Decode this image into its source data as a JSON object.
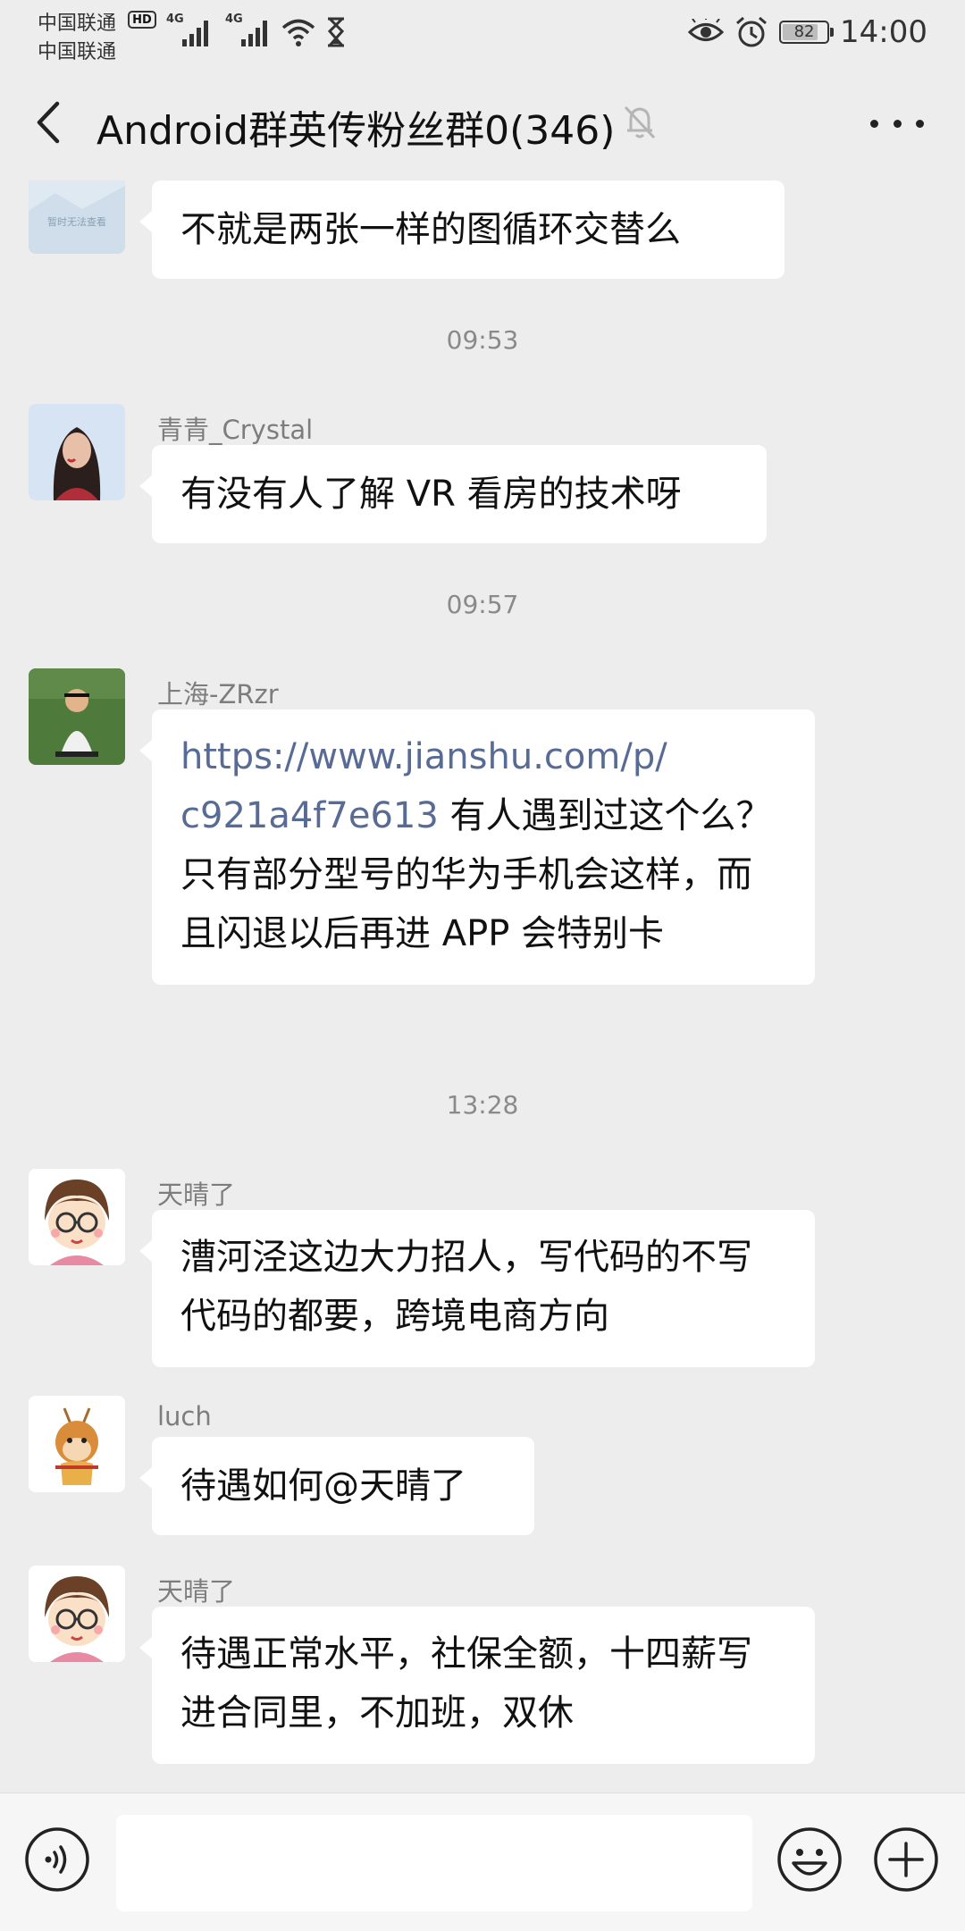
{
  "status_bar": {
    "carrier_1": "中国联通",
    "carrier_2": "中国联通",
    "hd_badge": "HD",
    "network_1": "4G",
    "network_2": "4G",
    "battery_level": "82",
    "battery_fraction": 0.82,
    "time": "14:00"
  },
  "header": {
    "title": "Android群英传粉丝群0(346)",
    "back_icon": "chevron-left-icon",
    "mute_icon": "bell-off-icon",
    "more_icon": "more-horizontal-icon"
  },
  "messages": [
    {
      "type": "message",
      "sender": "",
      "avatar_caption": "暂时无法查看",
      "text": "不就是两张一样的图循环交替么"
    },
    {
      "type": "timestamp",
      "text": "09:53"
    },
    {
      "type": "message",
      "sender": "青青_Crystal",
      "text": "有没有人了解 VR 看房的技术呀"
    },
    {
      "type": "timestamp",
      "text": "09:57"
    },
    {
      "type": "message",
      "sender": "上海-ZRzr",
      "link_line_1": "https://www.jianshu.com/p/",
      "link_line_2": "c921a4f7e613",
      "text_after_link": "  有人遇到过这个么？只有部分型号的华为手机会这样，而且闪退以后再进 APP 会特别卡"
    },
    {
      "type": "timestamp",
      "text": "13:28"
    },
    {
      "type": "message",
      "sender": "天晴了",
      "text": "漕河泾这边大力招人，写代码的不写代码的都要，跨境电商方向"
    },
    {
      "type": "message",
      "sender": "luch",
      "text": "待遇如何@天晴了"
    },
    {
      "type": "message",
      "sender": "天晴了",
      "text": "待遇正常水平，社保全额，十四薪写进合同里，不加班，双休"
    }
  ],
  "input_bar": {
    "voice_icon": "voice-icon",
    "input_value": "",
    "emoji_icon": "emoji-icon",
    "plus_icon": "plus-circle-icon"
  },
  "colors": {
    "background": "#ededed",
    "bubble": "#ffffff",
    "link": "#576b95",
    "secondary_text": "#8a8a8a"
  }
}
